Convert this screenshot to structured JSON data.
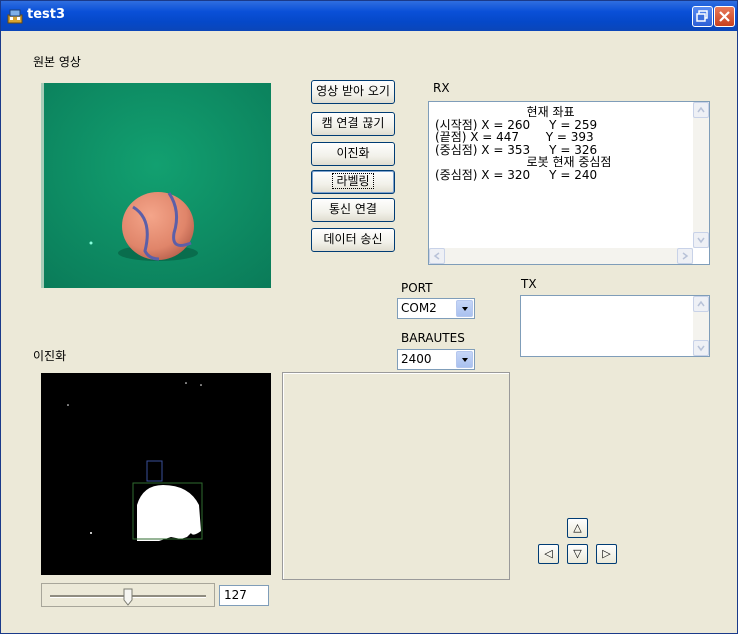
{
  "window": {
    "title": "test3"
  },
  "original": {
    "label": "원본 영상"
  },
  "binary": {
    "label": "이진화"
  },
  "buttons": {
    "receive_video": "영상 받아 오기",
    "cam_disconnect": "캠 연결 끊기",
    "binarize": "이진화",
    "labeling": "라벨링",
    "comm_connect": "통신 연결",
    "data_send": "데이터 송신"
  },
  "rx": {
    "label": "RX",
    "lines": "                        현재 좌표\n(시작점) X = 260     Y = 259\n(끝점) X = 447       Y = 393\n(중심점) X = 353     Y = 326\n                        로봇 현재 중심점\n(중심점) X = 320     Y = 240"
  },
  "tx": {
    "label": "TX",
    "value": ""
  },
  "port": {
    "label": "PORT",
    "selected": "COM2"
  },
  "baud": {
    "label": "BARAUTES",
    "selected": "2400"
  },
  "threshold": {
    "value": "127",
    "level": 0.5
  },
  "direction": {
    "up": "△",
    "left": "◁",
    "down": "▽",
    "right": "▷"
  },
  "colors": {
    "field": "#0f9568",
    "ball": "#e58c70",
    "titlebar": "#0a50d8",
    "dialog": "#ECE9D8",
    "bbox": "#2f6b2f"
  }
}
